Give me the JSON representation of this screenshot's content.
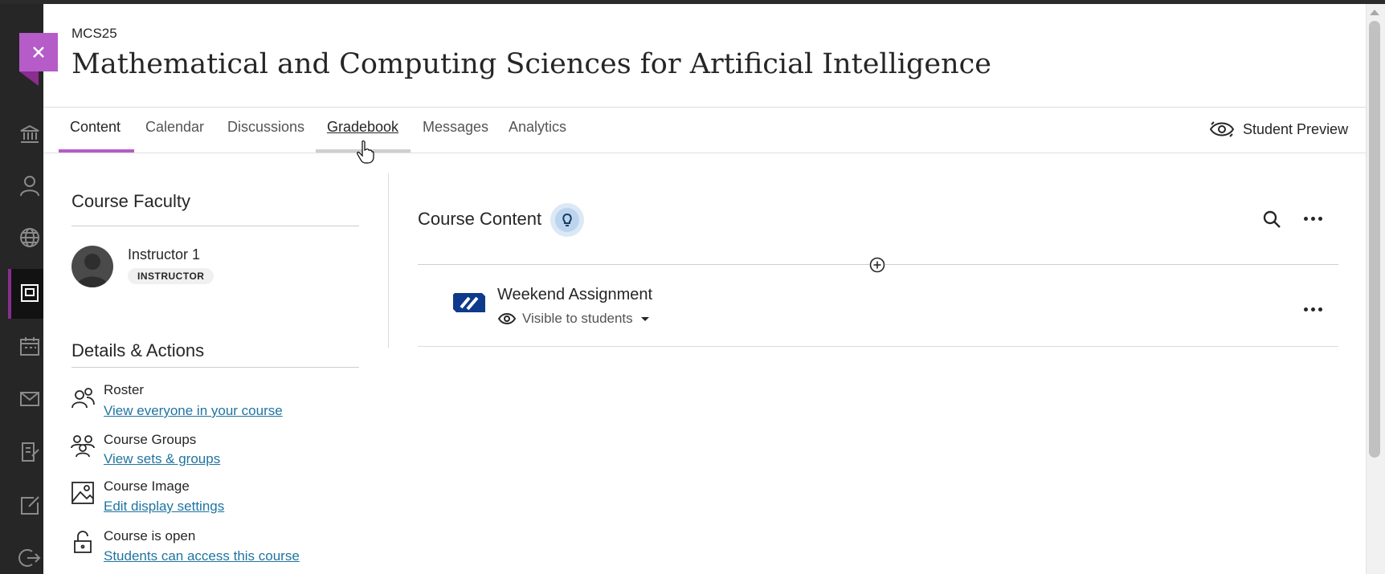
{
  "course": {
    "code": "MCS25",
    "title": "Mathematical and Computing Sciences for Artificial Intelligence"
  },
  "tabs": [
    {
      "label": "Content",
      "state": "active"
    },
    {
      "label": "Calendar",
      "state": "normal"
    },
    {
      "label": "Discussions",
      "state": "normal"
    },
    {
      "label": "Gradebook",
      "state": "hover"
    },
    {
      "label": "Messages",
      "state": "normal"
    },
    {
      "label": "Analytics",
      "state": "normal"
    }
  ],
  "header": {
    "student_preview_label": "Student Preview"
  },
  "faculty": {
    "heading": "Course Faculty",
    "instructor_name": "Instructor 1",
    "instructor_role": "INSTRUCTOR"
  },
  "details": {
    "heading": "Details & Actions",
    "items": [
      {
        "title": "Roster",
        "link": "View everyone in your course",
        "icon": "roster-icon"
      },
      {
        "title": "Course Groups",
        "link": "View sets & groups",
        "icon": "groups-icon"
      },
      {
        "title": "Course Image",
        "link": "Edit display settings",
        "icon": "image-icon"
      },
      {
        "title": "Course is open",
        "link": "Students can access this course",
        "icon": "unlock-icon"
      }
    ]
  },
  "content": {
    "heading": "Course Content",
    "items": [
      {
        "title": "Weekend Assignment",
        "visibility": "Visible to students",
        "icon": "assignment-icon"
      }
    ]
  },
  "leftnav": {
    "icons": [
      "institution-icon",
      "profile-icon",
      "globe-icon",
      "courses-icon",
      "calendar-icon",
      "messages-icon",
      "grades-icon",
      "tools-icon",
      "signout-icon"
    ],
    "active": "courses-icon"
  },
  "colors": {
    "accent": "#b55cc9",
    "accent_dark": "#8a2d8f",
    "link": "#1f74a1",
    "nav_bg": "#262626",
    "item_icon": "#0e3a8c"
  }
}
